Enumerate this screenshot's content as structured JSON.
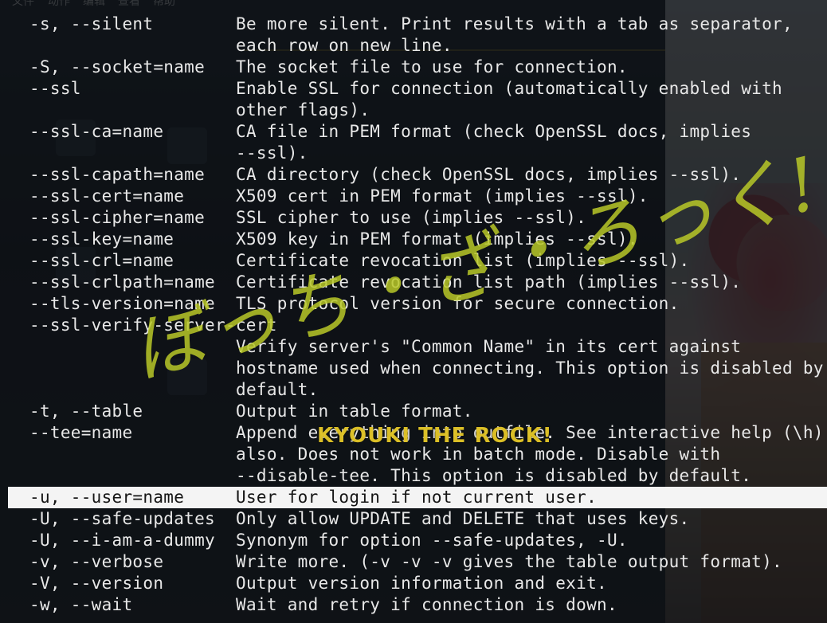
{
  "menubar": {
    "items": [
      "文件",
      "动作",
      "编辑",
      "查看",
      "帮助"
    ]
  },
  "terminal": {
    "lines": [
      {
        "opt": "-s, --silent",
        "desc": "Be more silent. Print results with a tab as separator,"
      },
      {
        "opt": "",
        "desc": "each row on new line."
      },
      {
        "opt": "-S, --socket=name",
        "desc": "The socket file to use for connection."
      },
      {
        "opt": "--ssl",
        "desc": "Enable SSL for connection (automatically enabled with"
      },
      {
        "opt": "",
        "desc": "other flags)."
      },
      {
        "opt": "--ssl-ca=name",
        "desc": "CA file in PEM format (check OpenSSL docs, implies"
      },
      {
        "opt": "",
        "desc": "--ssl)."
      },
      {
        "opt": "--ssl-capath=name",
        "desc": "CA directory (check OpenSSL docs, implies --ssl)."
      },
      {
        "opt": "--ssl-cert=name",
        "desc": "X509 cert in PEM format (implies --ssl)."
      },
      {
        "opt": "--ssl-cipher=name",
        "desc": "SSL cipher to use (implies --ssl)."
      },
      {
        "opt": "--ssl-key=name",
        "desc": "X509 key in PEM format (implies --ssl)."
      },
      {
        "opt": "--ssl-crl=name",
        "desc": "Certificate revocation list (implies --ssl)."
      },
      {
        "opt": "--ssl-crlpath=name",
        "desc": "Certificate revocation list path (implies --ssl)."
      },
      {
        "opt": "--tls-version=name",
        "desc": "TLS protocol version for secure connection."
      },
      {
        "opt": "--ssl-verify-server-cert",
        "desc": ""
      },
      {
        "opt": "",
        "desc": "Verify server's \"Common Name\" in its cert against"
      },
      {
        "opt": "",
        "desc": "hostname used when connecting. This option is disabled by"
      },
      {
        "opt": "",
        "desc": "default."
      },
      {
        "opt": "-t, --table",
        "desc": "Output in table format."
      },
      {
        "opt": "--tee=name",
        "desc": "Append everything into outfile. See interactive help (\\h)"
      },
      {
        "opt": "",
        "desc": "also. Does not work in batch mode. Disable with"
      },
      {
        "opt": "",
        "desc": "--disable-tee. This option is disabled by default."
      },
      {
        "opt": "-u, --user=name",
        "desc": "User for login if not current user."
      },
      {
        "opt": "-U, --safe-updates",
        "desc": "Only allow UPDATE and DELETE that uses keys."
      },
      {
        "opt": "-U, --i-am-a-dummy",
        "desc": "Synonym for option --safe-updates, -U."
      },
      {
        "opt": "-v, --verbose",
        "desc": "Write more. (-v -v -v gives the table output format)."
      },
      {
        "opt": "-V, --version",
        "desc": "Output version information and exit."
      },
      {
        "opt": "-w, --wait",
        "desc": "Wait and retry if connection is down."
      }
    ],
    "highlighted_line": 22
  },
  "overlays": {
    "brush_text": "ぼっち・ざ・ろっく!",
    "stamp_text": "KYOUKI THE ROCK!"
  },
  "colors": {
    "terminal_text": "#e8e8e8",
    "highlight_bg": "#f4f4f4",
    "brush": "#b9c828",
    "stamp": "#e6c828"
  }
}
